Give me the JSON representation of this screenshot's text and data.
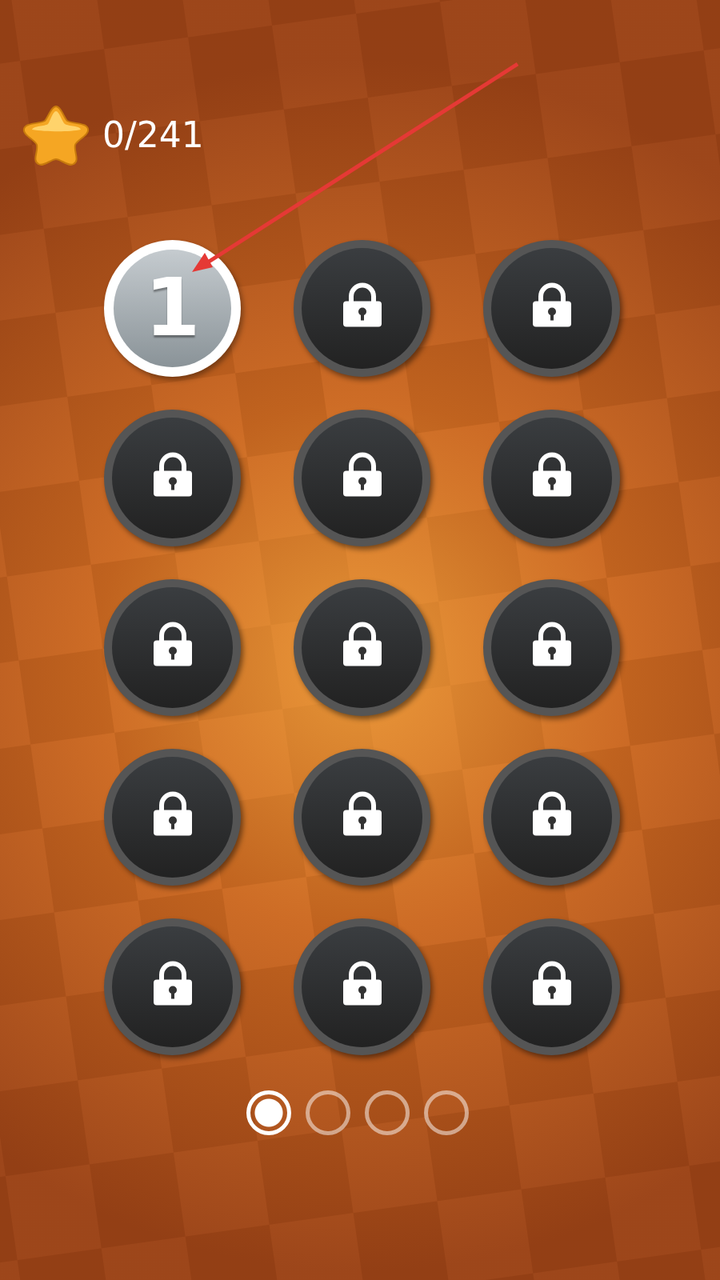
{
  "stars_counter": {
    "text": "0/241"
  },
  "levels": [
    {
      "label": "1",
      "locked": false
    },
    {
      "locked": true
    },
    {
      "locked": true
    },
    {
      "locked": true
    },
    {
      "locked": true
    },
    {
      "locked": true
    },
    {
      "locked": true
    },
    {
      "locked": true
    },
    {
      "locked": true
    },
    {
      "locked": true
    },
    {
      "locked": true
    },
    {
      "locked": true
    },
    {
      "locked": true
    },
    {
      "locked": true
    },
    {
      "locked": true
    }
  ],
  "pages": [
    {
      "selected": true
    },
    {
      "selected": false
    },
    {
      "selected": false
    },
    {
      "selected": false
    }
  ]
}
